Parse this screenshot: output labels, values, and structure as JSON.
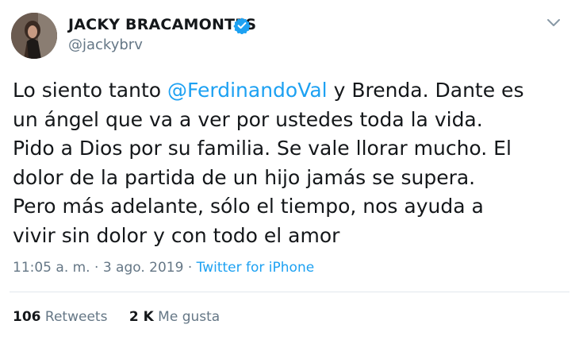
{
  "author": {
    "display_name": "JACKY BRACAMONTES",
    "handle": "@jackybrv",
    "verified_icon": "verified-badge-icon",
    "avatar_icon": "avatar-photo"
  },
  "menu": {
    "icon": "chevron-down-icon"
  },
  "tweet": {
    "lines": [
      {
        "before": "Lo siento tanto ",
        "mention": "@FerdinandoVal",
        "after": " y Brenda. Dante es"
      },
      {
        "text": "un ángel que va a ver por ustedes toda la vida."
      },
      {
        "text": "Pido a Dios por su familia. Se vale llorar mucho. El"
      },
      {
        "text": "dolor de la partida de un hijo jamás se supera."
      },
      {
        "text": "Pero más adelante, sólo el tiempo, nos ayuda a"
      },
      {
        "text": "vivir sin dolor y con todo el amor"
      }
    ]
  },
  "meta": {
    "time": "11:05 a. m.",
    "date": "3 ago. 2019",
    "separator": "·",
    "source": "Twitter for iPhone"
  },
  "stats": {
    "retweets_count": "106",
    "retweets_label": "Retweets",
    "likes_count": "2 K",
    "likes_label": "Me gusta"
  },
  "colors": {
    "link": "#1da1f2",
    "secondary_text": "#657786",
    "primary_text": "#14171a",
    "divider": "#e1e8ed"
  }
}
